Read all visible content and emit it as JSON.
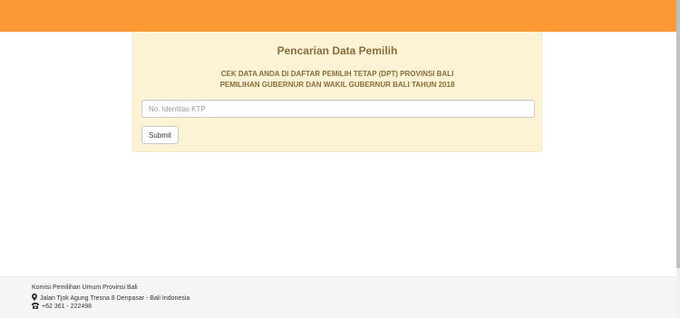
{
  "search": {
    "title": "Pencarian Data Pemilih",
    "subtitle_line1": "CEK DATA ANDA DI DAFTAR PEMILIH TETAP (DPT) PROVINSI BALI",
    "subtitle_line2": "PEMILIHAN GUBERNUR DAN WAKIL GUBERNUR BALI TAHUN 2018",
    "input_placeholder": "No. Identitas KTP",
    "input_value": "",
    "submit_label": "Submit"
  },
  "footer": {
    "org_name": "Komisi Pemilihan Umum Provinsi Bali",
    "address": "Jalan Tjok Agung Tresna 8 Denpasar - Bali Indonesia",
    "address_icon": "map-marker-icon",
    "phone": "+62 361 - 222498",
    "phone_icon": "phone-icon"
  },
  "colors": {
    "topbar": "#fd9935",
    "panel_bg": "#fcf3d5",
    "panel_text": "#8a6d3b",
    "footer_bg": "#f5f5f5"
  }
}
